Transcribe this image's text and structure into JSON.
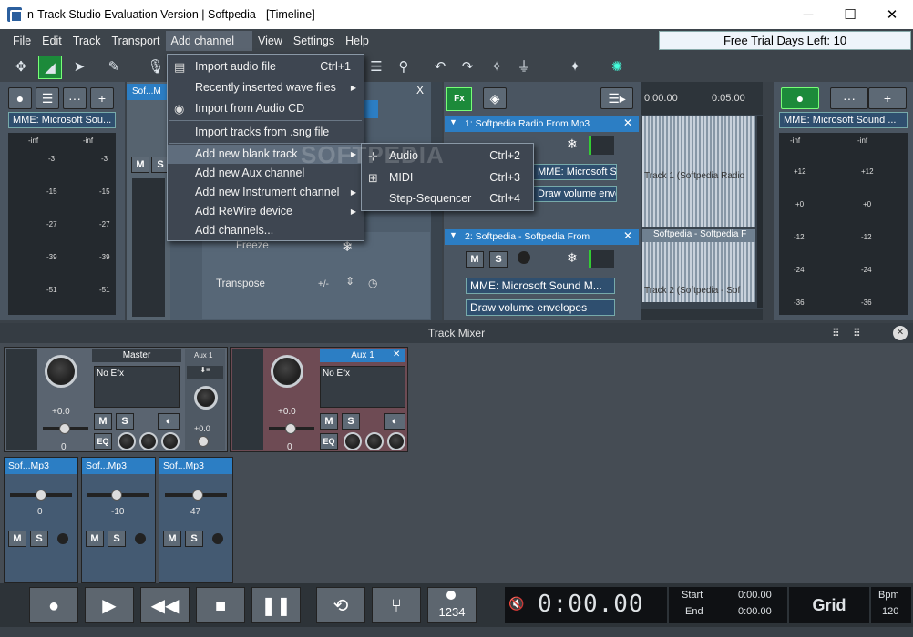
{
  "window": {
    "title": "n-Track Studio Evaluation Version | Softpedia - [Timeline]",
    "minimize": "─",
    "maximize": "☐",
    "close": "✕"
  },
  "menubar": {
    "items": [
      "File",
      "Edit",
      "Track",
      "Transport",
      "Add channel",
      "View",
      "Settings",
      "Help"
    ],
    "active": "Add channel",
    "trial": "Free Trial Days Left: 10"
  },
  "context_menu": {
    "items": [
      {
        "label": "Import audio file",
        "shortcut": "Ctrl+1",
        "icon": "import-audio-icon"
      },
      {
        "label": "Recently inserted wave files",
        "submenu": true
      },
      {
        "label": "Import from Audio CD",
        "icon": "cd-icon"
      },
      {
        "label": "Import tracks from .sng file"
      },
      {
        "label": "Add new blank track",
        "submenu": true,
        "highlighted": true
      },
      {
        "label": "Add new Aux channel"
      },
      {
        "label": "Add new Instrument channel",
        "submenu": true
      },
      {
        "label": "Add ReWire device",
        "submenu": true
      },
      {
        "label": "Add channels..."
      }
    ],
    "submenu": [
      {
        "label": "Audio",
        "shortcut": "Ctrl+2"
      },
      {
        "label": "MIDI",
        "shortcut": "Ctrl+3"
      },
      {
        "label": "Step-Sequencer",
        "shortcut": "Ctrl+4"
      }
    ]
  },
  "left_panel": {
    "device": "MME: Microsoft Sou...",
    "meter_labels": [
      "-inf",
      "-inf",
      "-3",
      "-3",
      "-15",
      "-15",
      "-27",
      "-27",
      "-39",
      "-39",
      "-51",
      "-51"
    ]
  },
  "right_panel": {
    "device": "MME: Microsoft Sound ...",
    "meter_labels": [
      "-inf",
      "-inf",
      "+12",
      "+12",
      "+0",
      "+0",
      "-12",
      "-12",
      "-24",
      "-24",
      "-36",
      "-36"
    ]
  },
  "channel_strip": {
    "name": "Sof...M",
    "mute": "M",
    "solo": "S"
  },
  "inspector": {
    "freeze": "Freeze",
    "transpose": "Transpose",
    "transpose_sign": "+/-",
    "close": "X"
  },
  "tracks": {
    "fx": "Fx",
    "timeline": {
      "t0": "0:00.00",
      "t1": "0:05.00"
    },
    "items": [
      {
        "name": "1: Softpedia Radio From Mp3",
        "device": "MME: Microsoft Sound M...",
        "envelopes": "Draw volume envelopes",
        "clip": "Track 1 (Softpedia Radio"
      },
      {
        "name": "2: Softpedia - Softpedia From",
        "device": "MME: Microsoft Sound M...",
        "envelopes": "Draw volume envelopes",
        "clip_title": "Softpedia - Softpedia F",
        "clip": "Track 2 (Softpedia - Sof"
      }
    ]
  },
  "mixer": {
    "title": "Track Mixer",
    "master": {
      "title": "Master",
      "efx": "No Efx",
      "value": "+0.0",
      "pan": "0",
      "mute": "M",
      "solo": "S",
      "eq": "EQ"
    },
    "aux_small": {
      "title": "Aux 1",
      "value": "+0.0"
    },
    "aux": {
      "title": "Aux 1",
      "efx": "No Efx",
      "value": "+0.0",
      "pan": "0",
      "mute": "M",
      "solo": "S",
      "eq": "EQ"
    },
    "tracks": [
      {
        "title": "Sof...Mp3",
        "pan": "0",
        "mute": "M",
        "solo": "S"
      },
      {
        "title": "Sof...Mp3",
        "pan": "-10",
        "mute": "M",
        "solo": "S"
      },
      {
        "title": "Sof...Mp3",
        "pan": "47",
        "mute": "M",
        "solo": "S"
      }
    ]
  },
  "transport": {
    "time": "0:00.00",
    "start_label": "Start",
    "end_label": "End",
    "start": "0:00.00",
    "end": "0:00.00",
    "grid": "Grid",
    "bpm_label": "Bpm",
    "bpm": "120",
    "count": "1234"
  },
  "watermark": "SOFTPEDIA"
}
